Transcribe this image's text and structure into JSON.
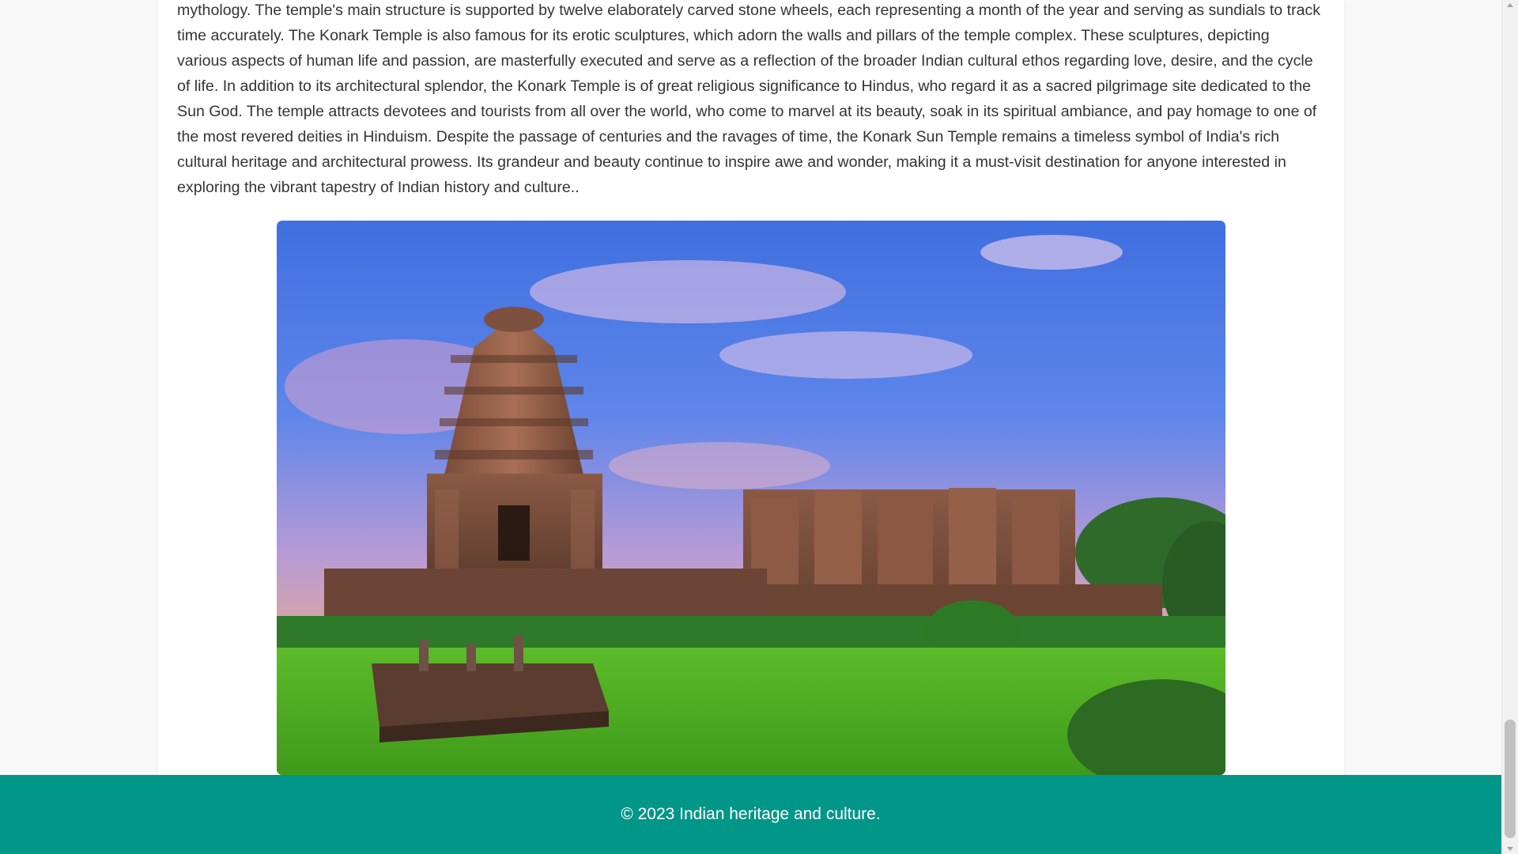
{
  "article": {
    "text": "mythology. The temple's main structure is supported by twelve elaborately carved stone wheels, each representing a month of the year and serving as sundials to track time accurately. The Konark Temple is also famous for its erotic sculptures, which adorn the walls and pillars of the temple complex. These sculptures, depicting various aspects of human life and passion, are masterfully executed and serve as a reflection of the broader Indian cultural ethos regarding love, desire, and the cycle of life. In addition to its architectural splendor, the Konark Temple is of great religious significance to Hindus, who regard it as a sacred pilgrimage site dedicated to the Sun God. The temple attracts devotees and tourists from all over the world, who come to marvel at its beauty, soak in its spiritual ambiance, and pay homage to one of the most revered deities in Hinduism. Despite the passage of centuries and the ravages of time, the Konark Sun Temple remains a timeless symbol of India's rich cultural heritage and architectural prowess. Its grandeur and beauty continue to inspire awe and wonder, making it a must-visit destination for anyone interested in exploring the vibrant tapestry of Indian history and culture.."
  },
  "footer": {
    "text": "© 2023 Indian heritage and culture."
  },
  "colors": {
    "footer_bg": "#009688",
    "page_bg": "#f8f8f8",
    "text": "#333333"
  }
}
